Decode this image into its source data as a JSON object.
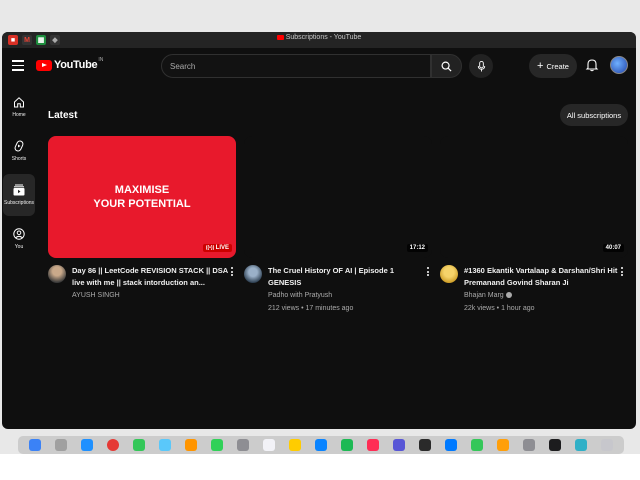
{
  "window": {
    "tab_title": "Subscriptions - YouTube"
  },
  "header": {
    "logo_text": "YouTube",
    "region": "IN",
    "search_placeholder": "Search",
    "create_label": "Create"
  },
  "sidebar": {
    "items": [
      {
        "label": "Home",
        "icon": "home-icon"
      },
      {
        "label": "Shorts",
        "icon": "shorts-icon"
      },
      {
        "label": "Subscriptions",
        "icon": "subscriptions-icon"
      },
      {
        "label": "You",
        "icon": "you-icon"
      }
    ]
  },
  "main": {
    "section_title": "Latest",
    "all_subscriptions_label": "All subscriptions",
    "videos": [
      {
        "thumbnail_text_line1": "MAXIMISE",
        "thumbnail_text_line2": "YOUR POTENTIAL",
        "badge": "LIVE",
        "title": "Day 86 || LeetCode REVISION STACK || DSA live with me || stack intorduction an...",
        "channel": "AYUSH SINGH",
        "stats": ""
      },
      {
        "duration": "17:12",
        "title": "The Cruel History OF AI | Episode 1 GENESIS",
        "channel": "Padho with Pratyush",
        "stats": "212 views • 17 minutes ago"
      },
      {
        "duration": "40:07",
        "title": "#1360 Ekantik Vartalaap & Darshan/Shri Hit Premanand Govind Sharan Ji",
        "channel": "Bhajan Marg",
        "stats": "22k views • 1 hour ago"
      }
    ]
  },
  "colors": {
    "background": "#0f0f0f",
    "accent_red": "#ff0000",
    "thumbnail_red": "#e8192c",
    "chip": "#272727"
  }
}
